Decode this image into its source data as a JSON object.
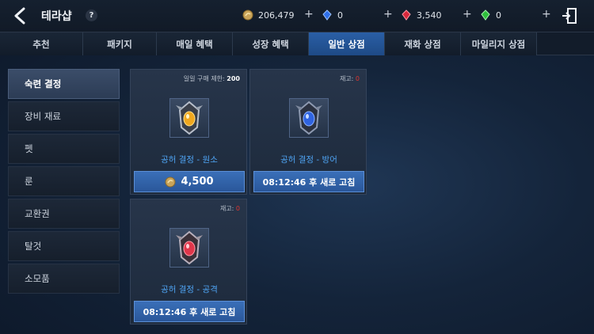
{
  "header": {
    "title": "테라샵",
    "help": "?",
    "currencies": [
      {
        "icon": "gold-coin-icon",
        "value": "206,479"
      },
      {
        "icon": "blue-crystal-icon",
        "value": "0"
      },
      {
        "icon": "red-crystal-icon",
        "value": "3,540"
      },
      {
        "icon": "green-crystal-icon",
        "value": "0"
      }
    ],
    "plus": "+"
  },
  "tabs": [
    {
      "label": "추천"
    },
    {
      "label": "패키지"
    },
    {
      "label": "매일 혜택"
    },
    {
      "label": "성장 혜택"
    },
    {
      "label": "일반 상점",
      "active": true
    },
    {
      "label": "재화 상점"
    },
    {
      "label": "마일리지 상점"
    }
  ],
  "sidebar": {
    "items": [
      {
        "label": "숙련 결정",
        "active": true
      },
      {
        "label": "장비 재료"
      },
      {
        "label": "펫"
      },
      {
        "label": "룬"
      },
      {
        "label": "교환권"
      },
      {
        "label": "탈것"
      },
      {
        "label": "소모품"
      }
    ]
  },
  "cards": [
    {
      "top_label": "일일 구매 제한:",
      "top_value": "200",
      "name": "공허 결정 - 원소",
      "gem_color": "#f0a71e",
      "button": "4,500"
    },
    {
      "top_label": "재고:",
      "top_value": "0",
      "name": "공허 결정 - 방어",
      "gem_color": "#2f63e0",
      "button": "08:12:46  후 새로 고침"
    },
    {
      "top_label": "재고:",
      "top_value": "0",
      "name": "공허 결정 - 공격",
      "gem_color": "#e0364a",
      "button": "08:12:46  후 새로 고침"
    }
  ],
  "colors": {
    "accent": "#2a579a",
    "item_name": "#4ea3f2",
    "stock_zero": "#e0352f"
  }
}
